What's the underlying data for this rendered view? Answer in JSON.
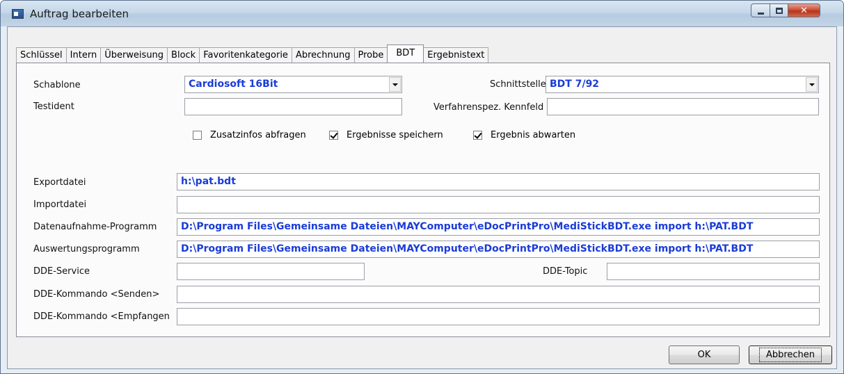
{
  "window": {
    "title": "Auftrag bearbeiten"
  },
  "tabs": [
    {
      "label": "Schlüssel"
    },
    {
      "label": "Intern"
    },
    {
      "label": "Überweisung"
    },
    {
      "label": "Block"
    },
    {
      "label": "Favoritenkategorie"
    },
    {
      "label": "Abrechnung"
    },
    {
      "label": "Probe"
    },
    {
      "label": "BDT",
      "active": true
    },
    {
      "label": "Ergebnistext"
    }
  ],
  "form": {
    "schablone_label": "Schablone",
    "schablone_value": "Cardiosoft 16Bit",
    "schnittstelle_label": "Schnittstelle",
    "schnittstelle_value": "BDT 7/92",
    "testident_label": "Testident",
    "testident_value": "",
    "kennfeld_label": "Verfahrenspez. Kennfeld",
    "kennfeld_value": "",
    "zusatzinfos_label": "Zusatzinfos abfragen",
    "zusatzinfos_checked": false,
    "ergebnisse_speichern_label": "Ergebnisse speichern",
    "ergebnisse_speichern_checked": true,
    "ergebnis_abwarten_label": "Ergebnis abwarten",
    "ergebnis_abwarten_checked": true,
    "exportdatei_label": "Exportdatei",
    "exportdatei_value": "h:\\pat.bdt",
    "importdatei_label": "Importdatei",
    "importdatei_value": "",
    "datenaufnahme_label": "Datenaufnahme-Programm",
    "datenaufnahme_value": "D:\\Program Files\\Gemeinsame Dateien\\MAYComputer\\eDocPrintPro\\MediStickBDT.exe import h:\\PAT.BDT",
    "auswertung_label": "Auswertungsprogramm",
    "auswertung_value": "D:\\Program Files\\Gemeinsame Dateien\\MAYComputer\\eDocPrintPro\\MediStickBDT.exe import h:\\PAT.BDT",
    "dde_service_label": "DDE-Service",
    "dde_service_value": "",
    "dde_topic_label": "DDE-Topic",
    "dde_topic_value": "",
    "dde_senden_label": "DDE-Kommando <Senden>",
    "dde_senden_value": "",
    "dde_empfangen_label": "DDE-Kommando <Empfangen",
    "dde_empfangen_value": ""
  },
  "buttons": {
    "ok": "OK",
    "cancel": "Abbrechen"
  },
  "colors": {
    "value_text": "#1a3cd8",
    "close_button": "#c8462e"
  }
}
